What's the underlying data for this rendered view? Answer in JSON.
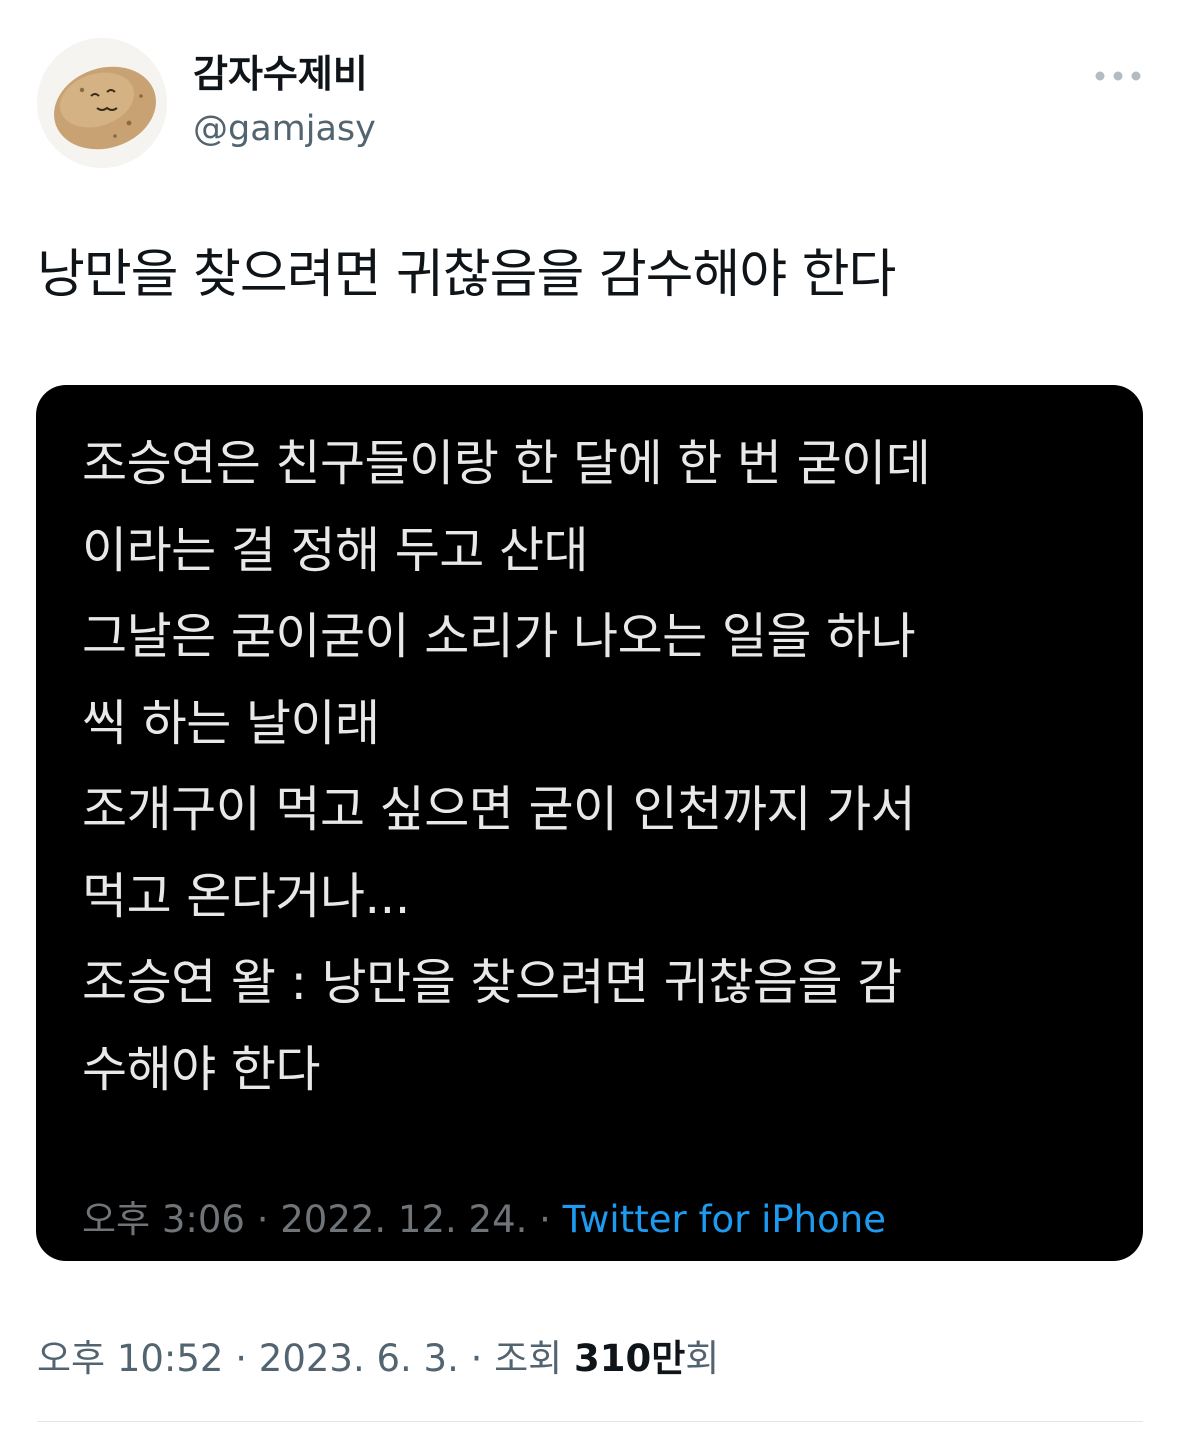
{
  "author": {
    "display_name": "감자수제비",
    "handle": "@gamjasy",
    "avatar_icon": "potato-face-icon"
  },
  "more_icon": "more-dots-icon",
  "tweet": {
    "text": "낭만을 찾으려면 귀찮음을 감수해야 한다",
    "time": "오후 10:52",
    "date": "2023. 6. 3.",
    "separator": "·",
    "views_label": "조회",
    "views_count": "310만",
    "views_suffix": "회"
  },
  "quoted_screenshot": {
    "lines": [
      "조승연은 친구들이랑 한 달에 한 번 굳이데",
      "이라는 걸 정해 두고 산대",
      "그날은 굳이굳이 소리가 나오는 일을 하나",
      "씩 하는 날이래",
      "조개구이 먹고 싶으면 굳이 인천까지 가서",
      "먹고 온다거나...",
      "조승연 왈 : 낭만을 찾으려면 귀찮음을 감",
      "수해야 한다"
    ],
    "time": "오후 3:06",
    "date": "2022. 12. 24.",
    "separator": "·",
    "source": "Twitter for iPhone"
  },
  "colors": {
    "text_primary": "#0f1419",
    "text_secondary": "#536471",
    "link": "#1d9bf0",
    "card_background": "#000000"
  }
}
